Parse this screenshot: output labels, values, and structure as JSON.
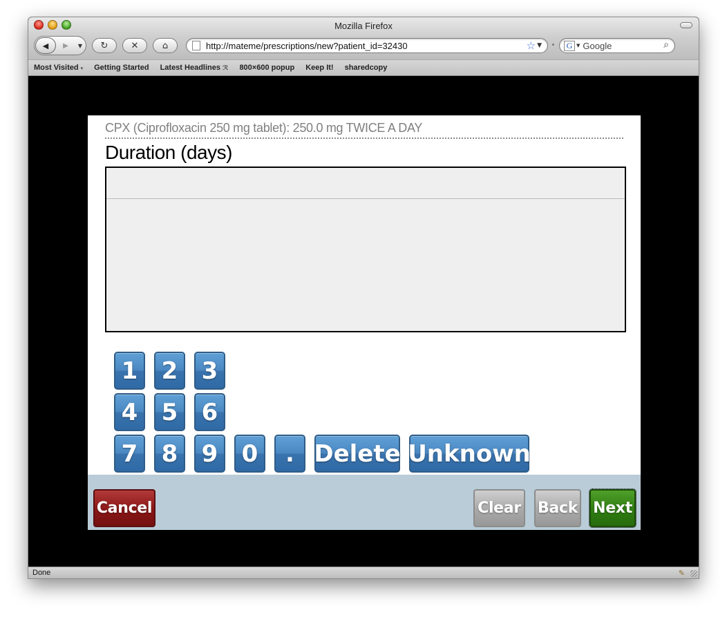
{
  "window": {
    "title": "Mozilla Firefox"
  },
  "toolbar": {
    "back_icon": "◀",
    "forward_icon": "▶",
    "history_icon": "▼",
    "reload_icon": "↻",
    "stop_icon": "✕",
    "home_icon": "⌂",
    "url": "http://mateme/prescriptions/new?patient_id=32430",
    "bookmark_star_icon": "☆",
    "url_dropdown_icon": "▼",
    "search_engine_letter": "G",
    "search_engine_arrow": "▼",
    "search_placeholder": "Google",
    "search_glass_icon": "⌕"
  },
  "bookmarks": [
    {
      "label": "Most Visited",
      "suffix": "▾"
    },
    {
      "label": "Getting Started"
    },
    {
      "label": "Latest Headlines",
      "suffix": "ℛ"
    },
    {
      "label": "800×600 popup"
    },
    {
      "label": "Keep It!"
    },
    {
      "label": "sharedcopy"
    }
  ],
  "status": {
    "text": "Done",
    "addon_icon": "✎"
  },
  "page": {
    "helper_text": "CPX (Ciprofloxacin 250 mg tablet): 250.0 mg TWICE A DAY",
    "question": "Duration (days)",
    "input_value": "",
    "keypad": {
      "row1": [
        "1",
        "2",
        "3"
      ],
      "row2": [
        "4",
        "5",
        "6"
      ],
      "row3": [
        "7",
        "8",
        "9",
        "0",
        "."
      ],
      "delete": "Delete",
      "unknown": "Unknown"
    },
    "footer": {
      "cancel": "Cancel",
      "clear": "Clear",
      "back": "Back",
      "next": "Next"
    }
  },
  "colors": {
    "key_blue": "#3f7db8",
    "cancel_red": "#8a1616",
    "next_green": "#2f7d12",
    "neutral_gray": "#a9a9a9",
    "footer_bg": "#b9ccd8"
  }
}
